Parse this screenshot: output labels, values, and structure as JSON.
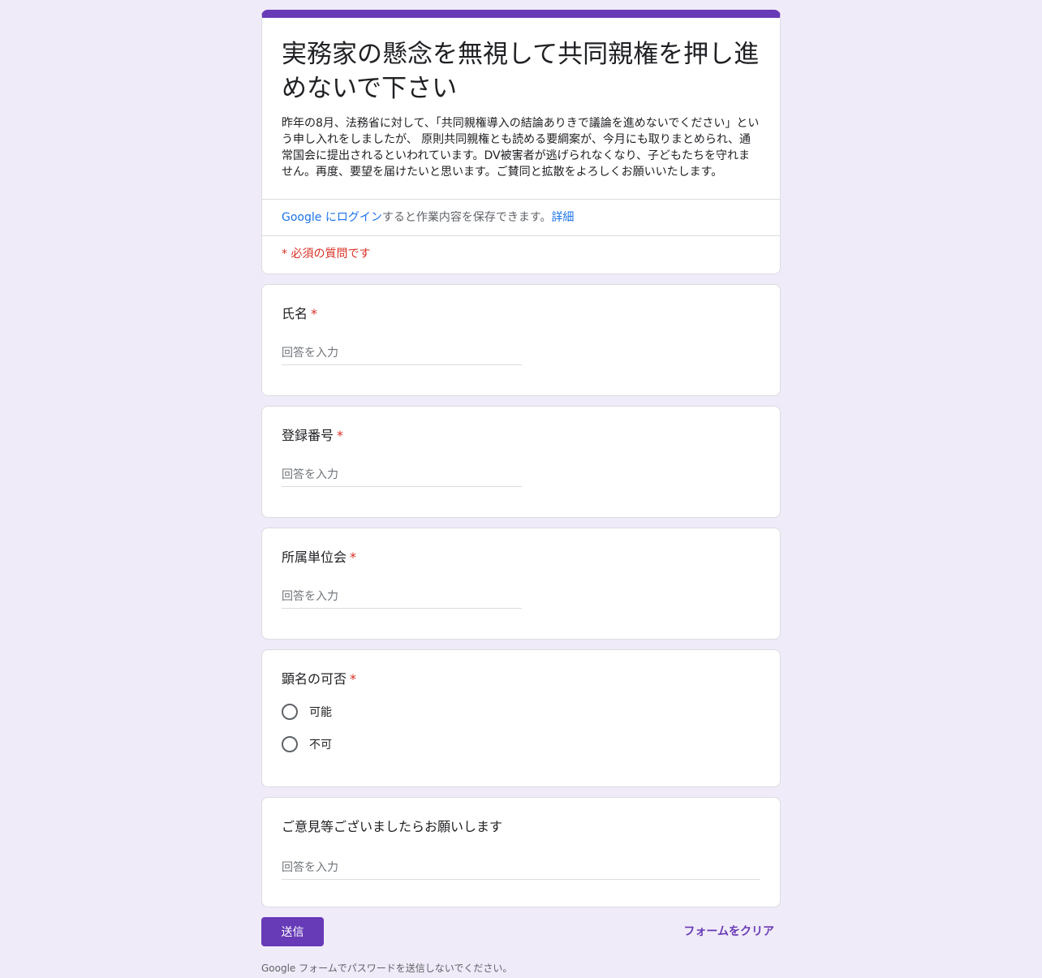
{
  "form": {
    "title": "実務家の懸念を無視して共同親権を押し進めないで下さい",
    "description": "昨年の8月、法務省に対して、「共同親権導入の結論ありきで議論を進めないでください」という申し入れをしましたが、 原則共同親権とも読める要綱案が、今月にも取りまとめられ、通常国会に提出されるといわれています。DV被害者が逃げられなくなり、子どもたちを守れません。再度、要望を届けたいと思います。ご賛同と拡散をよろしくお願いいたします。",
    "login_link": "Google にログイン",
    "login_text": "すると作業内容を保存できます。",
    "details_link": "詳細",
    "required_note": "* 必須の質問です"
  },
  "questions": {
    "name": {
      "title": "氏名",
      "star": "*",
      "placeholder": "回答を入力"
    },
    "reg_no": {
      "title": "登録番号",
      "star": "*",
      "placeholder": "回答を入力"
    },
    "affiliation": {
      "title": "所属単位会",
      "star": "*",
      "placeholder": "回答を入力"
    },
    "anon": {
      "title": "顕名の可否",
      "star": "*",
      "options": [
        "可能",
        "不可"
      ]
    },
    "comments": {
      "title": "ご意見等ございましたらお願いします",
      "placeholder": "回答を入力"
    }
  },
  "actions": {
    "submit_label": "送信",
    "clear_label": "フォームをクリア"
  },
  "footer": {
    "note": "Google フォームでパスワードを送信しないでください。"
  },
  "colors": {
    "accent": "#673ab7",
    "background": "#f0ebf8",
    "required": "#d93025",
    "link": "#1a73e8"
  }
}
